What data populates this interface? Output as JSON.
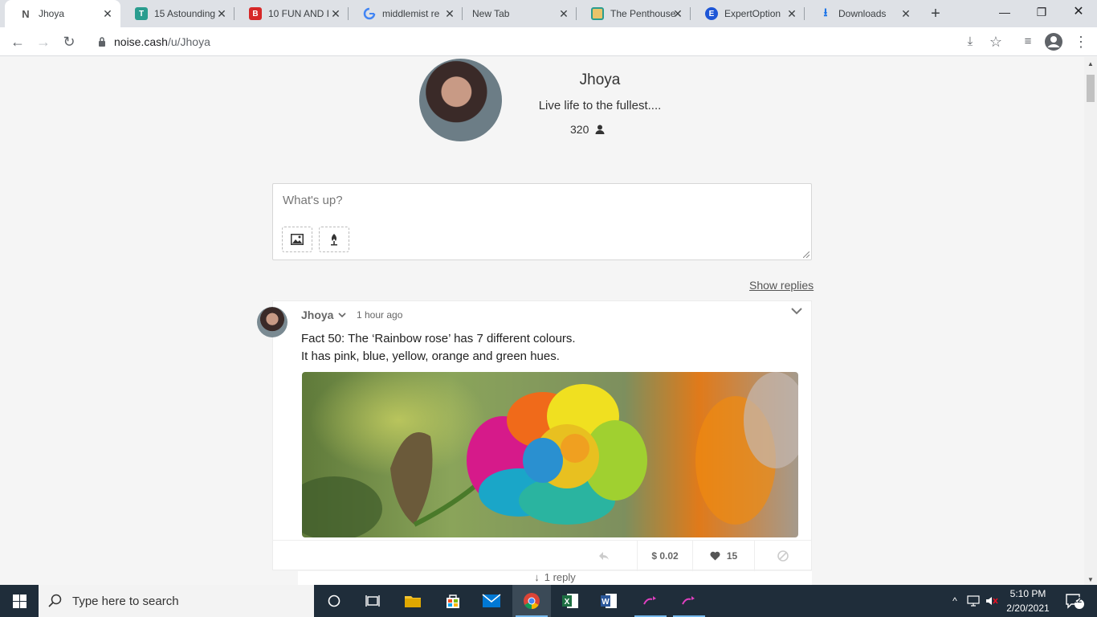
{
  "browser": {
    "tabs": [
      {
        "title": "Jhoya",
        "active": true,
        "favicon_color": "#ffffff"
      },
      {
        "title": "15 Astounding",
        "active": false,
        "favicon_color": "#2a9d8f"
      },
      {
        "title": "10 FUN AND I",
        "active": false,
        "favicon_color": "#d62828"
      },
      {
        "title": "middlemist re",
        "active": false,
        "favicon_color": "#ffffff"
      },
      {
        "title": "New Tab",
        "active": false,
        "favicon_color": ""
      },
      {
        "title": "The Penthouse",
        "active": false,
        "favicon_color": "#e9c46a"
      },
      {
        "title": "ExpertOption",
        "active": false,
        "favicon_color": "#1e56d6"
      },
      {
        "title": "Downloads",
        "active": false,
        "favicon_color": "#1a73e8"
      }
    ],
    "url_host": "noise.cash",
    "url_path": "/u/Jhoya"
  },
  "profile": {
    "name": "Jhoya",
    "bio": "Live life to the fullest....",
    "followers": "320"
  },
  "composer": {
    "placeholder": "What's up?"
  },
  "show_replies_label": "Show replies",
  "post": {
    "author": "Jhoya",
    "time": "1 hour ago",
    "line1": "Fact 50: The ‘Rainbow rose’ has 7 different colours.",
    "line2": "It has pink, blue, yellow, orange and green hues.",
    "tip_amount": "$ 0.02",
    "likes": "15",
    "replies_label": "1 reply"
  },
  "taskbar": {
    "search_placeholder": "Type here to search",
    "time": "5:10 PM",
    "date": "2/20/2021",
    "notifications": "12"
  }
}
